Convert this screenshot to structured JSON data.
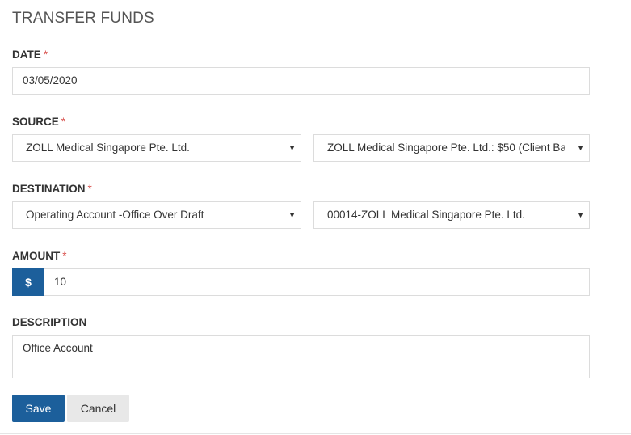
{
  "form": {
    "title": "TRANSFER FUNDS",
    "required_mark": "*",
    "date": {
      "label": "DATE",
      "value": "03/05/2020"
    },
    "source": {
      "label": "SOURCE",
      "account": "ZOLL Medical Singapore Pte. Ltd.",
      "balance": "ZOLL Medical Singapore Pte. Ltd.: $50 (Client Ba"
    },
    "destination": {
      "label": "DESTINATION",
      "account": "Operating Account -Office Over Draft",
      "matter": "00014-ZOLL Medical Singapore Pte. Ltd."
    },
    "amount": {
      "label": "AMOUNT",
      "currency_symbol": "$",
      "value": "10"
    },
    "description": {
      "label": "DESCRIPTION",
      "value": "Office Account"
    },
    "buttons": {
      "save": "Save",
      "cancel": "Cancel"
    }
  },
  "icons": {
    "caret": "chevron-down-icon"
  },
  "colors": {
    "primary": "#1c5f9b",
    "required": "#d9534f",
    "secondary_button": "#e8e8e8",
    "border": "#dcdcdc"
  }
}
